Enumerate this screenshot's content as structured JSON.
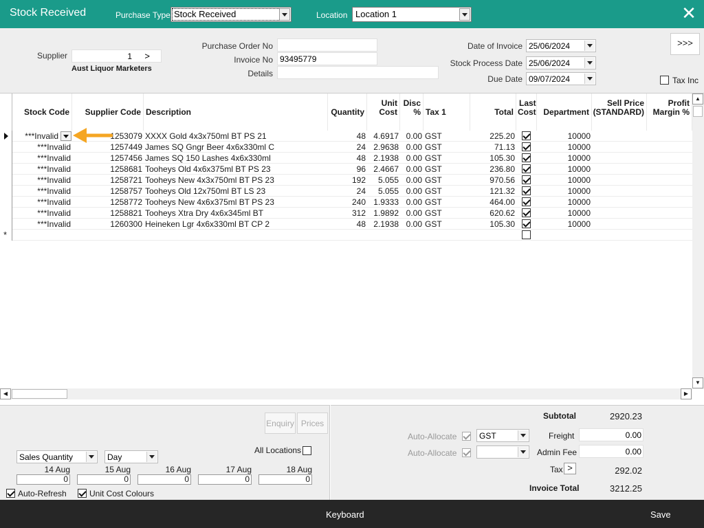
{
  "titlebar": {
    "title": "Stock Received",
    "purchase_type_label": "Purchase Type",
    "purchase_type_value": "Stock Received",
    "location_label": "Location",
    "location_value": "Location 1"
  },
  "header": {
    "supplier_label": "Supplier",
    "supplier_value": "1",
    "supplier_arrow": ">",
    "supplier_name": "Aust Liquor Marketers",
    "po_label": "Purchase Order No",
    "po_value": "",
    "invoice_label": "Invoice No",
    "invoice_value": "93495779",
    "details_label": "Details",
    "details_value": "",
    "date_invoice_label": "Date of Invoice",
    "date_invoice_value": "25/06/2024",
    "stock_process_label": "Stock Process Date",
    "stock_process_value": "25/06/2024",
    "due_date_label": "Due Date",
    "due_date_value": "09/07/2024",
    "more_button": ">>>",
    "tax_inc_label": "Tax Inc"
  },
  "grid": {
    "columns": {
      "stock_code": "Stock Code",
      "supplier_code": "Supplier Code",
      "description": "Description",
      "quantity": "Quantity",
      "unit_cost_1": "Unit",
      "unit_cost_2": "Cost",
      "disc_1": "Disc",
      "disc_2": "%",
      "tax1": "Tax 1",
      "total": "Total",
      "last_cost_1": "Last",
      "last_cost_2": "Cost",
      "department": "Department",
      "sell_price_1": "Sell Price",
      "sell_price_2": "(STANDARD)",
      "profit_1": "Profit",
      "profit_2": "Margin %"
    },
    "new_row_marker": "*",
    "rows": [
      {
        "stock_code": "***Invalid",
        "supplier_code": "1253079",
        "description": "XXXX Gold 4x3x750ml BT PS 21",
        "quantity": "48",
        "unit_cost": "4.6917",
        "disc": "0.00",
        "tax": "GST",
        "total": "225.20",
        "department": "10000"
      },
      {
        "stock_code": "***Invalid",
        "supplier_code": "1257449",
        "description": "James SQ Gngr Beer 4x6x330ml C",
        "quantity": "24",
        "unit_cost": "2.9638",
        "disc": "0.00",
        "tax": "GST",
        "total": "71.13",
        "department": "10000"
      },
      {
        "stock_code": "***Invalid",
        "supplier_code": "1257456",
        "description": "James SQ 150 Lashes 4x6x330ml",
        "quantity": "48",
        "unit_cost": "2.1938",
        "disc": "0.00",
        "tax": "GST",
        "total": "105.30",
        "department": "10000"
      },
      {
        "stock_code": "***Invalid",
        "supplier_code": "1258681",
        "description": "Tooheys Old 4x6x375ml BT PS 23",
        "quantity": "96",
        "unit_cost": "2.4667",
        "disc": "0.00",
        "tax": "GST",
        "total": "236.80",
        "department": "10000"
      },
      {
        "stock_code": "***Invalid",
        "supplier_code": "1258721",
        "description": "Tooheys New 4x3x750ml BT PS 23",
        "quantity": "192",
        "unit_cost": "5.055",
        "disc": "0.00",
        "tax": "GST",
        "total": "970.56",
        "department": "10000"
      },
      {
        "stock_code": "***Invalid",
        "supplier_code": "1258757",
        "description": "Tooheys Old 12x750ml BT LS 23",
        "quantity": "24",
        "unit_cost": "5.055",
        "disc": "0.00",
        "tax": "GST",
        "total": "121.32",
        "department": "10000"
      },
      {
        "stock_code": "***Invalid",
        "supplier_code": "1258772",
        "description": "Tooheys New 4x6x375ml BT PS 23",
        "quantity": "240",
        "unit_cost": "1.9333",
        "disc": "0.00",
        "tax": "GST",
        "total": "464.00",
        "department": "10000"
      },
      {
        "stock_code": "***Invalid",
        "supplier_code": "1258821",
        "description": "Tooheys Xtra Dry 4x6x345ml BT",
        "quantity": "312",
        "unit_cost": "1.9892",
        "disc": "0.00",
        "tax": "GST",
        "total": "620.62",
        "department": "10000"
      },
      {
        "stock_code": "***Invalid",
        "supplier_code": "1260300",
        "description": "Heineken Lgr 4x6x330ml BT CP 2",
        "quantity": "48",
        "unit_cost": "2.1938",
        "disc": "0.00",
        "tax": "GST",
        "total": "105.30",
        "department": "10000"
      }
    ]
  },
  "bottom_left": {
    "enquiry": "Enquiry",
    "prices": "Prices",
    "sales_select": "Sales Quantity",
    "period_select": "Day",
    "all_locations": "All Locations",
    "days": [
      {
        "label": "14 Aug",
        "value": "0"
      },
      {
        "label": "15 Aug",
        "value": "0"
      },
      {
        "label": "16 Aug",
        "value": "0"
      },
      {
        "label": "17 Aug",
        "value": "0"
      },
      {
        "label": "18 Aug",
        "value": "0"
      }
    ],
    "auto_refresh": "Auto-Refresh",
    "unit_cost_colours": "Unit Cost Colours"
  },
  "bottom_right": {
    "subtotal_label": "Subtotal",
    "subtotal_value": "2920.23",
    "auto_allocate_1": "Auto-Allocate",
    "auto_allocate_2": "Auto-Allocate",
    "freight_tax": "GST",
    "admin_tax": "",
    "freight_label": "Freight",
    "freight_value": "0.00",
    "admin_fee_label": "Admin Fee",
    "admin_fee_value": "0.00",
    "tax_label": "Tax",
    "tax_arrow": ">",
    "tax_value": "292.02",
    "invoice_total_label": "Invoice Total",
    "invoice_total_value": "3212.25"
  },
  "footer": {
    "keyboard": "Keyboard",
    "save": "Save"
  },
  "colors": {
    "titlebar": "#1a9b8a",
    "footer": "#262626",
    "arrow": "#f5a623"
  }
}
